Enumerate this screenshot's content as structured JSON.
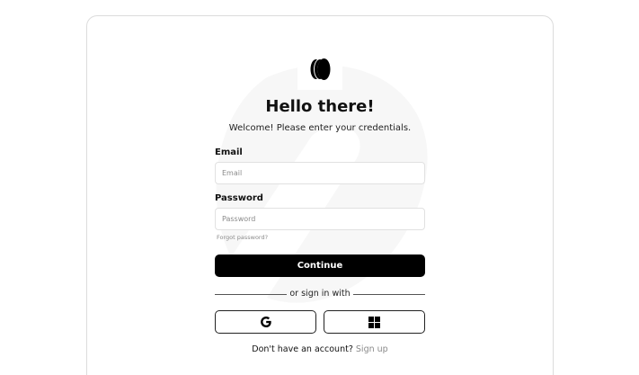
{
  "brand": {
    "logo_icon": "stacked-circles-logo-icon"
  },
  "header": {
    "title": "Hello there!",
    "subtitle": "Welcome! Please enter your credentials."
  },
  "form": {
    "email_label": "Email",
    "email_placeholder": "Email",
    "email_value": "",
    "password_label": "Password",
    "password_placeholder": "Password",
    "password_value": "",
    "forgot_label": "Forgot password?",
    "submit_label": "Continue"
  },
  "social": {
    "divider_label": "or sign in with",
    "providers": [
      {
        "name": "Google",
        "icon": "google-icon"
      },
      {
        "name": "Microsoft",
        "icon": "windows-icon"
      }
    ]
  },
  "footer": {
    "prompt": "Don't have an account?",
    "link_label": "Sign up"
  },
  "colors": {
    "primary_button": "#000000",
    "muted_text": "#8a8a8a",
    "border": "#e1e1e1"
  }
}
